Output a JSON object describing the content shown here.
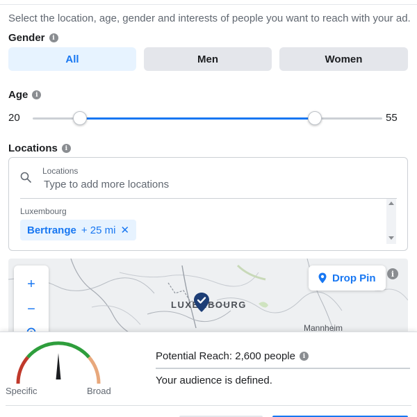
{
  "intro": "Select the location, age, gender and interests of people you want to reach with your ad.",
  "gender": {
    "label": "Gender",
    "info_icon": "i",
    "options": [
      "All",
      "Men",
      "Women"
    ],
    "selected": "All"
  },
  "age": {
    "label": "Age",
    "info_icon": "i",
    "min": "20",
    "max": "55",
    "range_min": 13,
    "range_max": 65
  },
  "locations": {
    "label": "Locations",
    "info_icon": "i",
    "field_label": "Locations",
    "placeholder": "Type to add more locations",
    "country": "Luxembourg",
    "chip": {
      "name": "Bertrange",
      "radius": "+ 25 mi",
      "remove": "✕"
    }
  },
  "map": {
    "zoom_in": "+",
    "zoom_out": "−",
    "drop_pin_label": "Drop Pin",
    "info_icon": "i",
    "place_labels": [
      "LUXEMBOURG",
      "Mannheim"
    ]
  },
  "summary": {
    "gauge_left_label": "Specific",
    "gauge_right_label": "Broad",
    "reach_text": "Potential Reach: 2,600 people",
    "info_icon": "i",
    "status_text": "Your audience is defined."
  },
  "colors": {
    "accent": "#1877f2",
    "selected_bg": "#e7f3ff",
    "gauge_specific": "#c0392b",
    "gauge_middle": "#2e9e3c",
    "gauge_broad": "#e8a87c"
  },
  "icons": {
    "search": "search-icon",
    "info": "info-icon",
    "map_pin": "map-pin-icon",
    "locate": "locate-icon",
    "location_marker": "location-marker-icon",
    "close": "close-icon"
  }
}
